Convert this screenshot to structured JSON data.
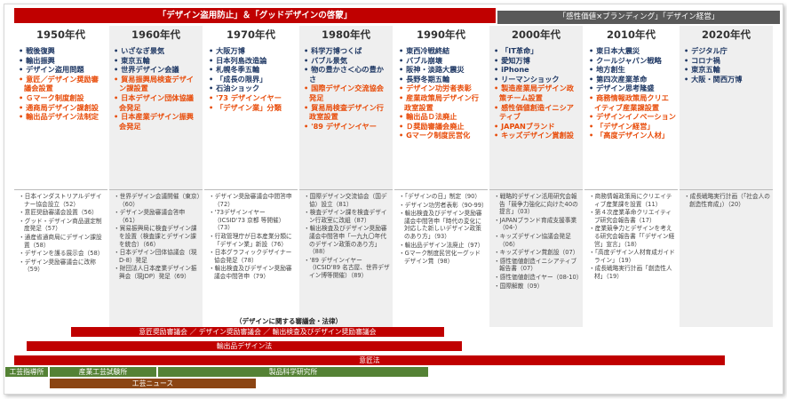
{
  "banners": {
    "main": "「デザイン盗用防止」＆「グッドデザインの啓蒙」",
    "secondary": "「感性価値×ブランディング」「デザイン経営」"
  },
  "decades": [
    {
      "label": "1950年代",
      "events": [
        {
          "text": "戦後復興",
          "style": "blue"
        },
        {
          "text": "輸出振興",
          "style": "blue"
        },
        {
          "text": "デザイン盗用問題",
          "style": "blue"
        },
        {
          "text": "意匠／デザイン奨励審議会設置",
          "style": "red"
        },
        {
          "text": "Ｇマーク制度創設",
          "style": "red"
        },
        {
          "text": "通商局デザイン課創設",
          "style": "red"
        },
        {
          "text": "輸出品デザイン法制定",
          "style": "red"
        }
      ],
      "details": [
        "日本インダストリアルデザイナー協会設立（52）",
        "意匠奨励審議会設置（56）",
        "グッド・デザイン商品選定制度発足（57）",
        "通産省通商局にデザイン課設置（58）",
        "デザインを護る展示会（58）",
        "デザイン奨励審議会に改称（59）"
      ]
    },
    {
      "label": "1960年代",
      "events": [
        {
          "text": "いざなぎ景気",
          "style": "blue"
        },
        {
          "text": "東京五輪",
          "style": "blue"
        },
        {
          "text": "世界デザイン会議",
          "style": "blue"
        },
        {
          "text": "貿易振興局検査デザイン課設置",
          "style": "red"
        },
        {
          "text": "日本デザイン団体協議会発足",
          "style": "red"
        },
        {
          "text": "日本産業デザイン振興会発足",
          "style": "red"
        }
      ],
      "details": [
        "世界デザイン会議開催（東京）（60）",
        "デザイン奨励審議会答申（61）",
        "貿易振興局に検査デザイン課を設置（検査課とデザイン課を統合）（66）",
        "日本デザイン団体協議会（現D-8）発足",
        "財団法人日本産業デザイン振興会（現JDP）発足（69）"
      ]
    },
    {
      "label": "1970年代",
      "events": [
        {
          "text": "大阪万博",
          "style": "blue"
        },
        {
          "text": "日本列島改造論",
          "style": "blue"
        },
        {
          "text": "札幌冬季五輪",
          "style": "blue"
        },
        {
          "text": "「成長の限界」",
          "style": "blue"
        },
        {
          "text": "石油ショック",
          "style": "blue"
        },
        {
          "text": "'73 デザインイヤー",
          "style": "red"
        },
        {
          "text": "「デザイン業」分類",
          "style": "red"
        }
      ],
      "details": [
        "デザイン奨励審議会中間答申（72）",
        "'73デザインイヤー（ICSID'73 京都 等開催）（73）",
        "行政管理庁が日本産業分類に「デザイン業」新設（76）",
        "日本グラフィックデザイナー協会発足（78）",
        "輸出検査及びデザイン奨励審議会中間答申（79）"
      ]
    },
    {
      "label": "1980年代",
      "events": [
        {
          "text": "科学万博つくば",
          "style": "blue"
        },
        {
          "text": "バブル景気",
          "style": "blue"
        },
        {
          "text": "物の豊かさ＜心の豊かさ",
          "style": "blue"
        },
        {
          "text": "国際デザイン交流協会発足",
          "style": "red"
        },
        {
          "text": "貿易局検査デザイン行政室設置",
          "style": "red"
        },
        {
          "text": "'89 デザインイヤー",
          "style": "red"
        }
      ],
      "details": [
        "国際デザイン交流協会（国デ協）設立（81）",
        "検査デザイン課を検査デザイン行政室に改組（87）",
        "輸出検査及びデザイン奨励審議会中間答申「一九九〇年代のデザイン政策のあり方」（88）",
        "'89 デザインイヤー（ICSID'89 名古屋、世界デザイン博等開催）（89）"
      ]
    },
    {
      "label": "1990年代",
      "events": [
        {
          "text": "東西冷戦終結",
          "style": "blue"
        },
        {
          "text": "バブル崩壊",
          "style": "blue"
        },
        {
          "text": "阪神・淡路大震災",
          "style": "blue"
        },
        {
          "text": "長野冬期五輪",
          "style": "blue"
        },
        {
          "text": "デザイン功労者表彰",
          "style": "red"
        },
        {
          "text": "産業政策局デザイン行政室設置",
          "style": "red"
        },
        {
          "text": "輸出品Ｄ法廃止",
          "style": "red"
        },
        {
          "text": "Ｄ奨励審議会廃止",
          "style": "red"
        },
        {
          "text": "Gマーク制度民営化",
          "style": "red"
        }
      ],
      "details": [
        "「デザインの日」制定（90）",
        "デザイン功労者表彰（90-99）",
        "輸出検査及びデザイン奨励審議会中間答申「時代の変化に対応した新しいデザイン政策のあり方」（93）",
        "輸出品デザイン法廃止（97）",
        "Gマーク制度民営化ーグッドデザイン賞（98）"
      ]
    },
    {
      "label": "2000年代",
      "events": [
        {
          "text": "「IT革命」",
          "style": "blue"
        },
        {
          "text": "愛知万博",
          "style": "blue"
        },
        {
          "text": "iPhone",
          "style": "blue"
        },
        {
          "text": "リーマンショック",
          "style": "blue"
        },
        {
          "text": "製造産業局デザイン政策チーム設置",
          "style": "red"
        },
        {
          "text": "感性価値創造イニシアティブ",
          "style": "red"
        },
        {
          "text": "JAPANブランド",
          "style": "red"
        },
        {
          "text": "キッズデザイン賞創設",
          "style": "red"
        }
      ],
      "details": [
        "戦略的デザイン活用研究会報告「競争力強化に向けた40の提言」（03）",
        "JAPANブランド育成支援事業（04-）",
        "キッズデザイン協議会発足（06）",
        "キッズデザイン賞創設（07）",
        "感性価値創造イニシアティブ 報告書（07）",
        "感性価値創造イヤー（08-10）",
        "国際解散（09）"
      ]
    },
    {
      "label": "2010年代",
      "events": [
        {
          "text": "東日本大震災",
          "style": "blue"
        },
        {
          "text": "クールジャパン戦略",
          "style": "blue"
        },
        {
          "text": "地方創生",
          "style": "blue"
        },
        {
          "text": "第四次産業革命",
          "style": "blue"
        },
        {
          "text": "デザイン思考隆盛",
          "style": "blue"
        },
        {
          "text": "商務情報政策局クリエイティブ産業課設置",
          "style": "red"
        },
        {
          "text": "デザインイノベーション",
          "style": "red"
        },
        {
          "text": "「デザイン経営」",
          "style": "red"
        },
        {
          "text": "「高度デザイン人材」",
          "style": "red"
        }
      ],
      "details": [
        "商務情報政策局にクリエイティブ産業課を設置（11）",
        "第４次産業革命クリエイティブ研究会報告書（17）",
        "産業競争力とデザインを考える研究会報告書「「デザイン経営」宣言」（18）",
        "「高度デザイン人材育成ガイドライン」（19）",
        "成長戦略実行計画「創造性人材」（19）"
      ]
    },
    {
      "label": "2020年代",
      "events": [
        {
          "text": "デジタル庁",
          "style": "blue"
        },
        {
          "text": "コロナ禍",
          "style": "blue"
        },
        {
          "text": "東京五輪",
          "style": "blue"
        },
        {
          "text": "大阪・関西万博",
          "style": "blue"
        }
      ],
      "details": [
        "成長戦略実行計画（「社会人の創造性育成」）（20）"
      ]
    }
  ],
  "timeline_note": "（デザインに関する審議会・法律）",
  "bars": {
    "bar1": "意匠奨励審議会 ／ デザイン奨励審議会 ／ 輸出検査及びデザイン奨励審議会",
    "bar2": "輸出品デザイン法",
    "bar3": "意匠法",
    "bar4": "工芸指導所",
    "bar5": "産業工芸試験所",
    "bar6": "製品科学研究所",
    "bar7": "工芸ニュース"
  }
}
